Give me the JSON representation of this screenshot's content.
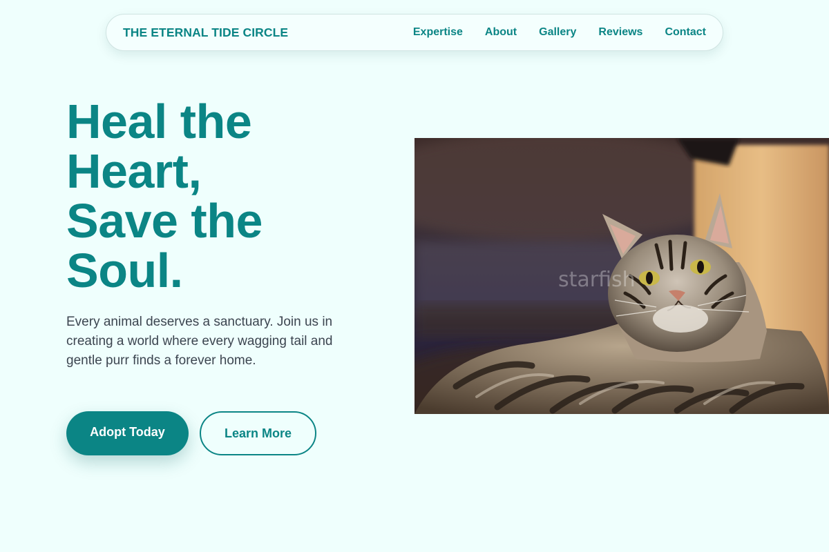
{
  "nav": {
    "brand": "THE ETERNAL TIDE CIRCLE",
    "links": [
      "Expertise",
      "About",
      "Gallery",
      "Reviews",
      "Contact"
    ]
  },
  "hero": {
    "title_lines": [
      "Heal the",
      "Heart,",
      "Save the",
      "Soul."
    ],
    "description": "Every animal deserves a sanctuary. Join us in creating a world where every wagging tail and gentle purr finds a forever home.",
    "primary_button": "Adopt Today",
    "secondary_button": "Learn More",
    "image": {
      "subject": "tabby cat lying down",
      "watermark": "starfish"
    }
  },
  "colors": {
    "background": "#effffd",
    "accent": "#0b8585",
    "body_text": "#3c4550"
  }
}
